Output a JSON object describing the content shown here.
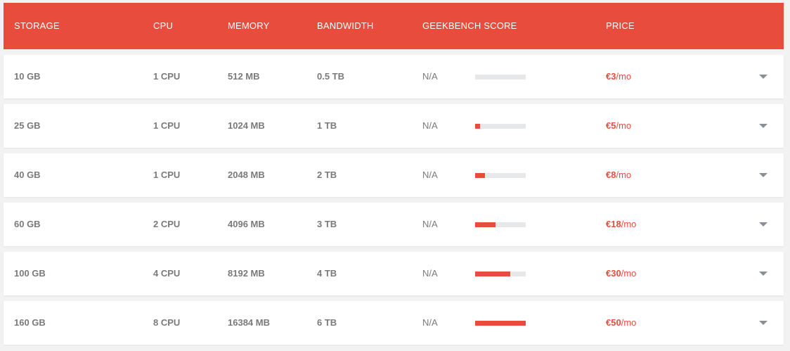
{
  "header": {
    "storage": "STORAGE",
    "cpu": "CPU",
    "memory": "MEMORY",
    "bandwidth": "BANDWIDTH",
    "geekbench": "GEEKBENCH SCORE",
    "price": "PRICE"
  },
  "colors": {
    "accent": "#e84c3d",
    "text": "#7a7a7a",
    "track": "#e6e8ea"
  },
  "plans": [
    {
      "storage": "10 GB",
      "cpu": "1 CPU",
      "memory": "512 MB",
      "bandwidth": "0.5 TB",
      "geekbench": "N/A",
      "score_fraction": 0.0,
      "price_amount": "€3",
      "price_unit": "/mo",
      "expand_icon": "chevron-down-icon"
    },
    {
      "storage": "25 GB",
      "cpu": "1 CPU",
      "memory": "1024 MB",
      "bandwidth": "1 TB",
      "geekbench": "N/A",
      "score_fraction": 0.1,
      "price_amount": "€5",
      "price_unit": "/mo",
      "expand_icon": "chevron-down-icon"
    },
    {
      "storage": "40 GB",
      "cpu": "1 CPU",
      "memory": "2048 MB",
      "bandwidth": "2 TB",
      "geekbench": "N/A",
      "score_fraction": 0.2,
      "price_amount": "€8",
      "price_unit": "/mo",
      "expand_icon": "chevron-down-icon"
    },
    {
      "storage": "60 GB",
      "cpu": "2 CPU",
      "memory": "4096 MB",
      "bandwidth": "3 TB",
      "geekbench": "N/A",
      "score_fraction": 0.4,
      "price_amount": "€18",
      "price_unit": "/mo",
      "expand_icon": "chevron-down-icon"
    },
    {
      "storage": "100 GB",
      "cpu": "4 CPU",
      "memory": "8192 MB",
      "bandwidth": "4 TB",
      "geekbench": "N/A",
      "score_fraction": 0.7,
      "price_amount": "€30",
      "price_unit": "/mo",
      "expand_icon": "chevron-down-icon"
    },
    {
      "storage": "160 GB",
      "cpu": "8 CPU",
      "memory": "16384 MB",
      "bandwidth": "6 TB",
      "geekbench": "N/A",
      "score_fraction": 1.0,
      "price_amount": "€50",
      "price_unit": "/mo",
      "expand_icon": "chevron-down-icon"
    }
  ]
}
